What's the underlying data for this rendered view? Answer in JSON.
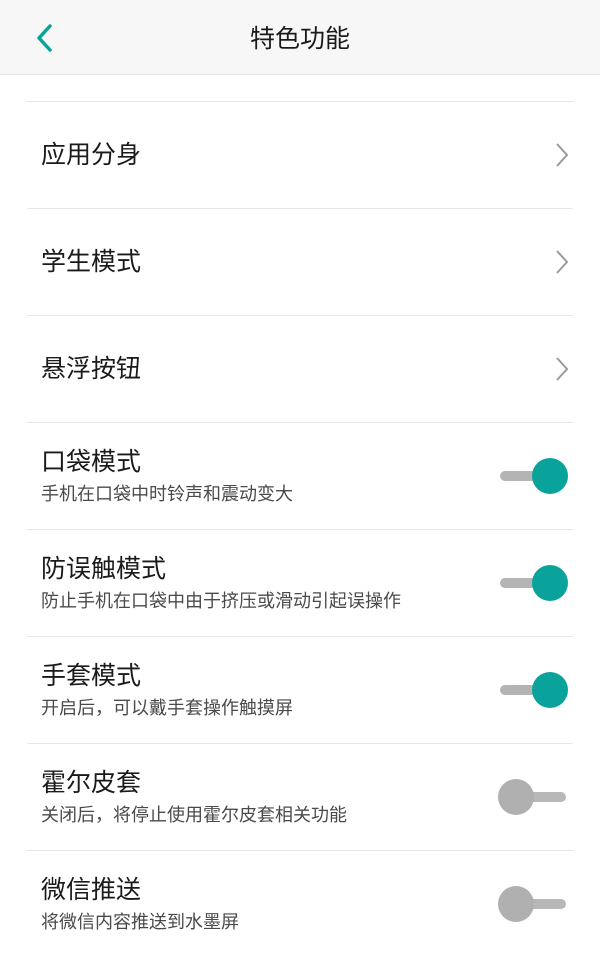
{
  "header": {
    "title": "特色功能",
    "back_icon": "chevron-left-icon",
    "accent_color": "#0aa39c"
  },
  "items": [
    {
      "label": "应用分身",
      "type": "nav"
    },
    {
      "label": "学生模式",
      "type": "nav"
    },
    {
      "label": "悬浮按钮",
      "type": "nav"
    },
    {
      "label": "口袋模式",
      "desc": "手机在口袋中时铃声和震动变大",
      "type": "toggle",
      "on": true
    },
    {
      "label": "防误触模式",
      "desc": "防止手机在口袋中由于挤压或滑动引起误操作",
      "type": "toggle",
      "on": true
    },
    {
      "label": "手套模式",
      "desc": "开启后，可以戴手套操作触摸屏",
      "type": "toggle",
      "on": true
    },
    {
      "label": "霍尔皮套",
      "desc": "关闭后，将停止使用霍尔皮套相关功能",
      "type": "toggle",
      "on": false
    },
    {
      "label": "微信推送",
      "desc": "将微信内容推送到水墨屏",
      "type": "toggle",
      "on": false
    }
  ]
}
